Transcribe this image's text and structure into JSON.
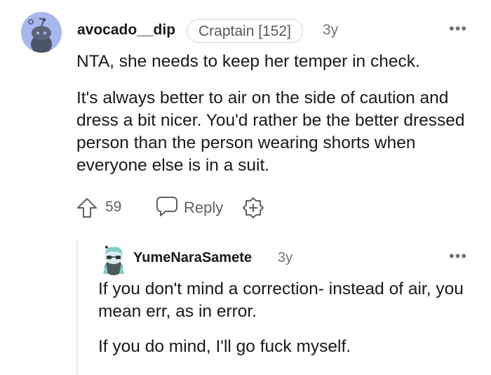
{
  "comment": {
    "username": "avocado__dip",
    "flair": "Craptain [152]",
    "age": "3y",
    "more": "•••",
    "paragraphs": [
      "NTA, she needs to keep her temper in check.",
      "It's always better to air on the side of caution and dress a bit nicer. You'd rather be the better dressed person than the person wearing shorts when everyone else is in a suit."
    ],
    "score": "59",
    "reply_label": "Reply"
  },
  "reply": {
    "username": "YumeNaraSamete",
    "age": "3y",
    "more": "•••",
    "paragraphs": [
      "If you don't mind a correction- instead of air, you mean err, as in error.",
      "If you do mind, I'll go fuck myself."
    ]
  },
  "colors": {
    "avatar_bg": "#a7b8f0",
    "text": "#1a1a1b",
    "meta": "#6f7478",
    "thread_line": "#e8eaec"
  }
}
